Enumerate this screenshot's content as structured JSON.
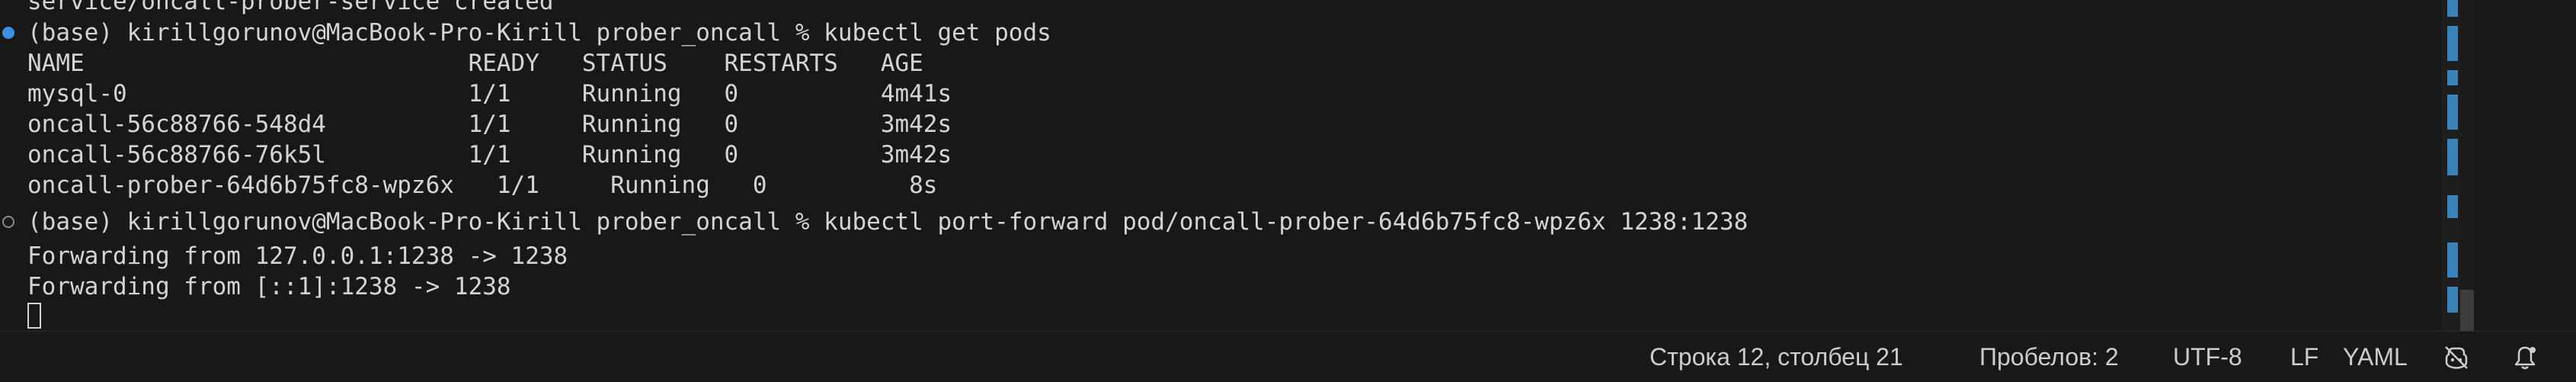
{
  "terminal": {
    "lines": [
      "service/oncall-prober-service created",
      "(base) kirillgorunov@MacBook-Pro-Kirill prober_oncall % kubectl get pods",
      "NAME                           READY   STATUS    RESTARTS   AGE",
      "mysql-0                        1/1     Running   0          4m41s",
      "oncall-56c88766-548d4          1/1     Running   0          3m42s",
      "oncall-56c88766-76k5l          1/1     Running   0          3m42s",
      "oncall-prober-64d6b75fc8-wpz6x   1/1     Running   0          8s",
      "(base) kirillgorunov@MacBook-Pro-Kirill prober_oncall % kubectl port-forward pod/oncall-prober-64d6b75fc8-wpz6x 1238:1238",
      "Forwarding from 127.0.0.1:1238 -> 1238",
      "Forwarding from [::1]:1238 -> 1238"
    ]
  },
  "status_bar": {
    "cursor_position": "Строка 12, столбец 21",
    "indentation": "Пробелов: 2",
    "encoding": "UTF-8",
    "eol": "LF",
    "language": "YAML",
    "icons": [
      "copilot-off-icon",
      "bell-icon"
    ]
  },
  "colors": {
    "background": "#181818",
    "text": "#d4d4d4",
    "decoration_success": "#3c8fdd",
    "ruler_mark": "#3a82b7"
  }
}
